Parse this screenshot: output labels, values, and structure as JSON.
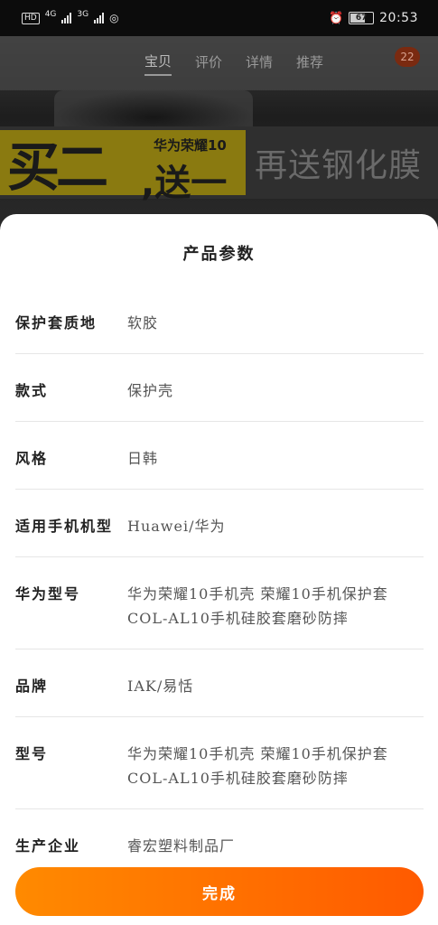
{
  "status_bar": {
    "hd": "HD",
    "network_1": "4G",
    "network_2": "3G",
    "battery": "67",
    "time": "20:53",
    "alarm_icon": "alarm-icon"
  },
  "background": {
    "tabs": [
      "宝贝",
      "评价",
      "详情",
      "推荐"
    ],
    "active_tab": 0,
    "cart_badge": "22",
    "promo_big": "买二",
    "promo_sub": "华为荣耀10",
    "promo_send": ",送一",
    "promo_right": "再送钢化膜"
  },
  "sheet": {
    "title": "产品参数",
    "params": [
      {
        "label": "保护套质地",
        "value": "软胶"
      },
      {
        "label": "款式",
        "value": "保护壳"
      },
      {
        "label": "风格",
        "value": "日韩"
      },
      {
        "label": "适用手机机型",
        "value": "Huawei/华为"
      },
      {
        "label": "华为型号",
        "value": "华为荣耀10手机壳 荣耀10手机保护套COL-AL10手机硅胶套磨砂防摔"
      },
      {
        "label": "品牌",
        "value": "IAK/易恬"
      },
      {
        "label": "型号",
        "value": "华为荣耀10手机壳 荣耀10手机保护套COL-AL10手机硅胶套磨砂防摔"
      },
      {
        "label": "生产企业",
        "value": "睿宏塑料制品厂"
      }
    ],
    "done_label": "完成"
  },
  "colors": {
    "accent_start": "#ff8a00",
    "accent_end": "#ff5a00"
  }
}
